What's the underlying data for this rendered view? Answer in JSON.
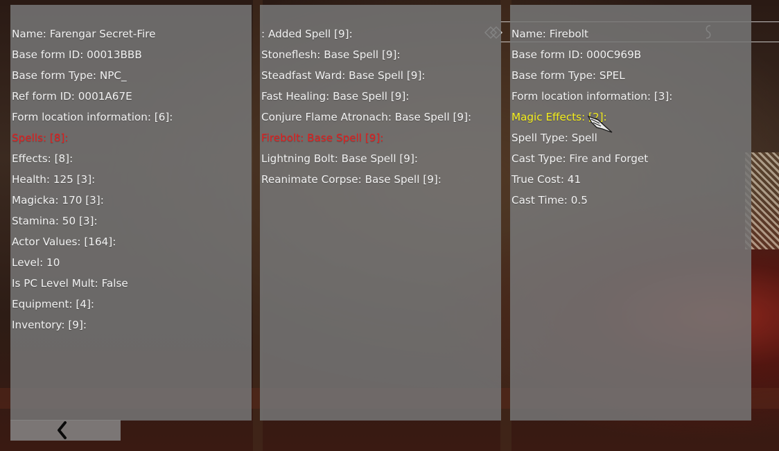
{
  "left_panel": {
    "rows": [
      {
        "text": "Name: Farengar Secret-Fire",
        "state": "normal"
      },
      {
        "text": "Base form ID: 00013BBB",
        "state": "normal"
      },
      {
        "text": "Base form Type: NPC_",
        "state": "normal"
      },
      {
        "text": "Ref form ID: 0001A67E",
        "state": "normal"
      },
      {
        "text": "Form location information:  [6]:",
        "state": "normal"
      },
      {
        "text": "Spells:  [8]:",
        "state": "selected"
      },
      {
        "text": "Effects:  [8]:",
        "state": "normal"
      },
      {
        "text": "Health: 125 [3]:",
        "state": "normal"
      },
      {
        "text": "Magicka: 170 [3]:",
        "state": "normal"
      },
      {
        "text": "Stamina: 50 [3]:",
        "state": "normal"
      },
      {
        "text": "Actor Values:  [164]:",
        "state": "normal"
      },
      {
        "text": "Level: 10",
        "state": "normal"
      },
      {
        "text": "Is PC Level Mult: False",
        "state": "normal"
      },
      {
        "text": "Equipment:  [4]:",
        "state": "normal"
      },
      {
        "text": "Inventory:  [9]:",
        "state": "normal"
      }
    ]
  },
  "middle_panel": {
    "rows": [
      {
        "text": ": Added Spell [9]:",
        "state": "normal"
      },
      {
        "text": "Stoneflesh: Base Spell [9]:",
        "state": "normal"
      },
      {
        "text": "Steadfast Ward: Base Spell [9]:",
        "state": "normal"
      },
      {
        "text": "Fast Healing: Base Spell [9]:",
        "state": "normal"
      },
      {
        "text": "Conjure Flame Atronach: Base Spell [9]:",
        "state": "normal"
      },
      {
        "text": "Firebolt: Base Spell [9]:",
        "state": "selected"
      },
      {
        "text": "Lightning Bolt: Base Spell [9]:",
        "state": "normal"
      },
      {
        "text": "Reanimate Corpse: Base Spell [9]:",
        "state": "normal"
      }
    ]
  },
  "right_panel": {
    "rows": [
      {
        "text": "Name: Firebolt",
        "state": "normal"
      },
      {
        "text": "Base form ID: 000C969B",
        "state": "normal"
      },
      {
        "text": "Base form Type: SPEL",
        "state": "normal"
      },
      {
        "text": "Form location information:  [3]:",
        "state": "normal"
      },
      {
        "text": "Magic Effects:  [2]:",
        "state": "hover"
      },
      {
        "text": "Spell Type: Spell",
        "state": "normal"
      },
      {
        "text": "Cast Type: Fire and Forget",
        "state": "normal"
      },
      {
        "text": "True Cost: 41",
        "state": "normal"
      },
      {
        "text": "Cast Time: 0.5",
        "state": "normal"
      }
    ]
  },
  "icons": {
    "back": "chevron-left-icon",
    "header_ornament": "diamond-ornament-icon",
    "header_swirl": "swirl-ornament-icon",
    "cursor": "dragon-claw-cursor-icon"
  },
  "colors": {
    "selected": "#e51d1d",
    "hover": "#f5ef1c",
    "text": "#f2f2f2",
    "panel": "#767676"
  }
}
